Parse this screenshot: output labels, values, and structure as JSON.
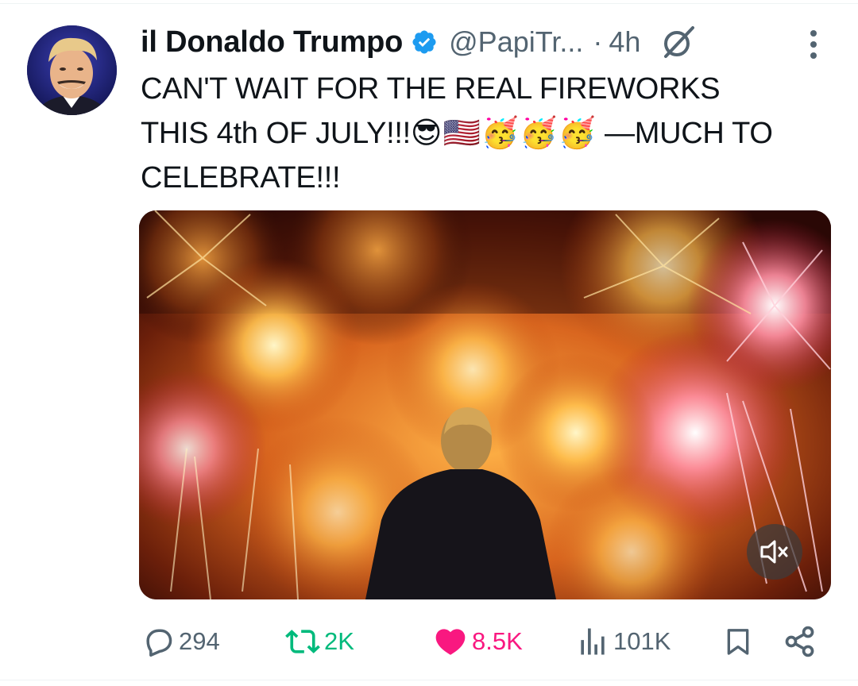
{
  "tweet": {
    "author": {
      "display_name": "il Donaldo Trumpo",
      "handle": "@PapiTr...",
      "verified": true
    },
    "separator": "·",
    "timestamp": "4h",
    "text_line1": "CAN'T WAIT FOR THE REAL FIREWORKS",
    "text_line2_start": "THIS 4th OF JULY!!!",
    "text_emojis": "😎🇺🇸🥳🥳🥳",
    "text_line2_end": " —MUCH TO",
    "text_line3": "CELEBRATE!!!",
    "media": {
      "type": "video",
      "muted": true
    }
  },
  "actions": {
    "replies": "294",
    "reposts": "2K",
    "likes": "8.5K",
    "views": "101K"
  },
  "icons": [
    "verified-badge-icon",
    "grok-icon",
    "more-icon",
    "mute-icon",
    "reply-icon",
    "repost-icon",
    "like-icon",
    "views-icon",
    "bookmark-icon",
    "share-icon"
  ],
  "colors": {
    "verified": "#1d9bf0",
    "secondary_text": "#536471",
    "repost_active": "#00ba7c",
    "like_active": "#f91880"
  }
}
